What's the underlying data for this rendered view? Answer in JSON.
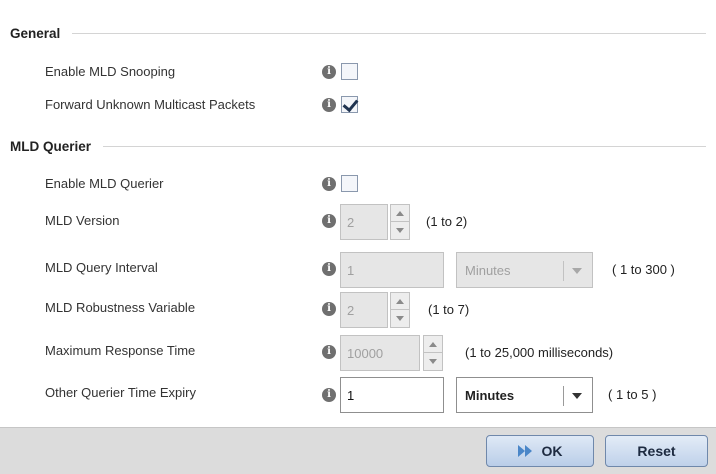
{
  "general": {
    "title": "General",
    "enable_mld_snooping": {
      "label": "Enable MLD Snooping",
      "checked": false
    },
    "forward_unknown_multicast": {
      "label": "Forward Unknown Multicast Packets",
      "checked": true
    }
  },
  "mld_querier": {
    "title": "MLD Querier",
    "enable_mld_querier": {
      "label": "Enable MLD Querier",
      "checked": false
    },
    "mld_version": {
      "label": "MLD Version",
      "value": "2",
      "hint": "(1 to 2)"
    },
    "mld_query_interval": {
      "label": "MLD Query Interval",
      "value": "1",
      "unit": "Minutes",
      "hint": "( 1 to 300 )"
    },
    "mld_robustness_variable": {
      "label": "MLD Robustness Variable",
      "value": "2",
      "hint": "(1 to 7)"
    },
    "maximum_response_time": {
      "label": "Maximum Response Time",
      "value": "10000",
      "hint": "(1 to 25,000 milliseconds)"
    },
    "other_querier_time_expiry": {
      "label": "Other Querier Time Expiry",
      "value": "1",
      "unit": "Minutes",
      "hint": "( 1 to 5 )"
    }
  },
  "footer": {
    "ok_label": "OK",
    "reset_label": "Reset"
  },
  "info_glyph": "i",
  "icons": {
    "info": "info-icon",
    "ok": "play-forward-icon"
  }
}
